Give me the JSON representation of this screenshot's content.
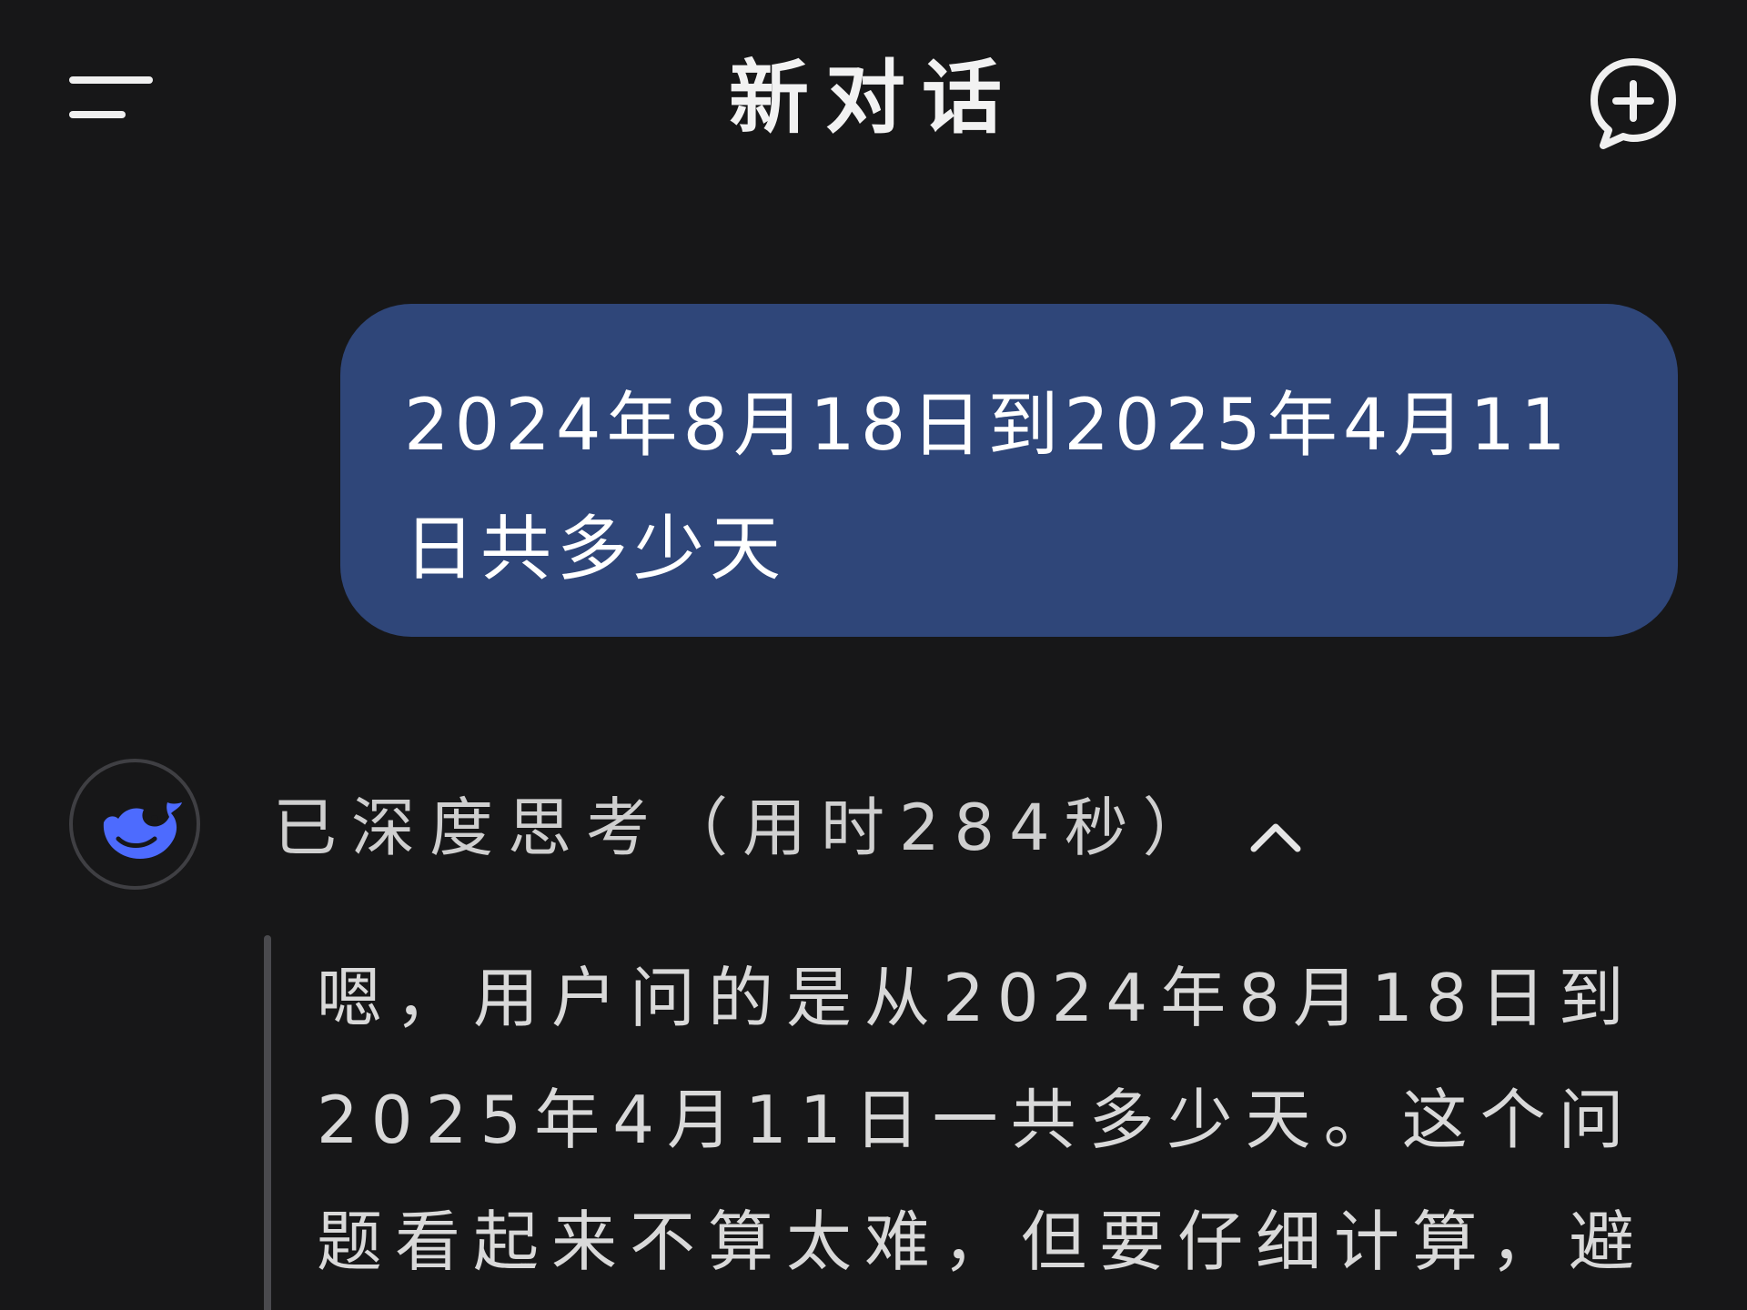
{
  "header": {
    "title": "新对话",
    "menu_icon": "menu-icon",
    "new_chat_icon": "new-chat-plus-icon"
  },
  "user_message": {
    "text": "2024年8月18日到2025年4月11日共多少天"
  },
  "assistant": {
    "avatar_icon": "deepseek-whale-icon",
    "accent_color": "#4d6bfe",
    "thinking_label": "已深度思考（用时284秒）",
    "thinking_toggle_icon": "chevron-up-icon",
    "thinking_text": "嗯，用户问的是从2024年8月18日到2025年4月11日一共多少天。这个问题看起来不算太难，但要仔细计算，避"
  },
  "colors": {
    "background": "#171718",
    "user_bubble": "#2f4679",
    "text": "#f2f2f2",
    "muted_text": "#cfcfcf"
  }
}
